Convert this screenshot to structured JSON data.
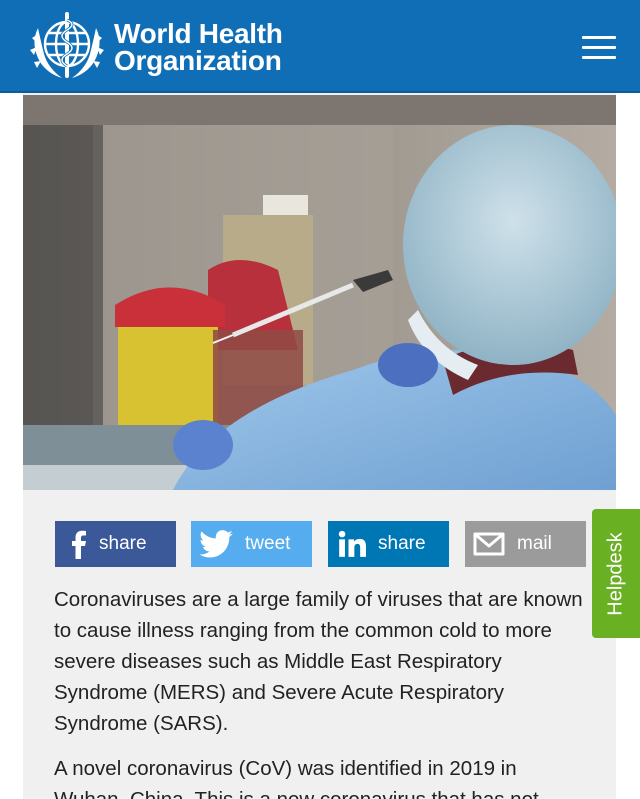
{
  "header": {
    "logo_line1": "World Health",
    "logo_line2": "Organization",
    "brand_color": "#0f6eb6",
    "menu_icon": "hamburger-menu-icon"
  },
  "share": {
    "facebook_label": "share",
    "twitter_label": "tweet",
    "linkedin_label": "share",
    "mail_label": "mail",
    "colors": {
      "facebook": "#3b5998",
      "twitter": "#55acee",
      "linkedin": "#0077b5",
      "mail": "#9b9b9b"
    }
  },
  "helpdesk": {
    "label": "Helpdesk",
    "color": "#6ab023"
  },
  "article": {
    "paragraph1": "Coronaviruses are a large family of viruses that are known to cause illness ranging from the common cold to more severe diseases such as Middle East Respiratory Syndrome (MERS) and Severe Acute Respiratory Syndrome (SARS).",
    "paragraph2": "A novel coronavirus (CoV) was identified in 2019 in Wuhan, China. This is a new coronavirus that has not"
  }
}
